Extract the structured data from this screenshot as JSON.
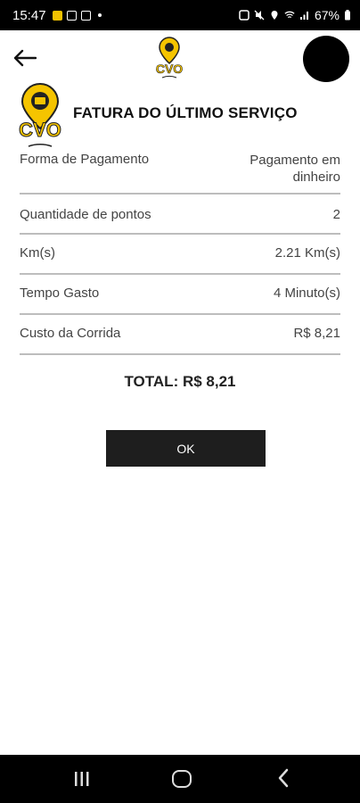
{
  "status_bar": {
    "time": "15:47",
    "battery": "67%"
  },
  "header": {
    "back_icon": "arrow-left-icon",
    "logo": "cvo-delivery-logo",
    "avatar_icon": "user-avatar"
  },
  "invoice": {
    "title": "FATURA DO ÚLTIMO SERVIÇO",
    "rows": [
      {
        "label": "Forma de Pagamento",
        "value": "Pagamento em dinheiro"
      },
      {
        "label": "Quantidade de pontos",
        "value": "2"
      },
      {
        "label": "Km(s)",
        "value": "2.21 Km(s)"
      },
      {
        "label": "Tempo Gasto",
        "value": "4 Minuto(s)"
      },
      {
        "label": "Custo da Corrida",
        "value": "R$ 8,21"
      }
    ],
    "total": "TOTAL: R$ 8,21",
    "ok_label": "OK"
  },
  "colors": {
    "brand_yellow": "#f5c400",
    "button_dark": "#1e1e1e"
  }
}
